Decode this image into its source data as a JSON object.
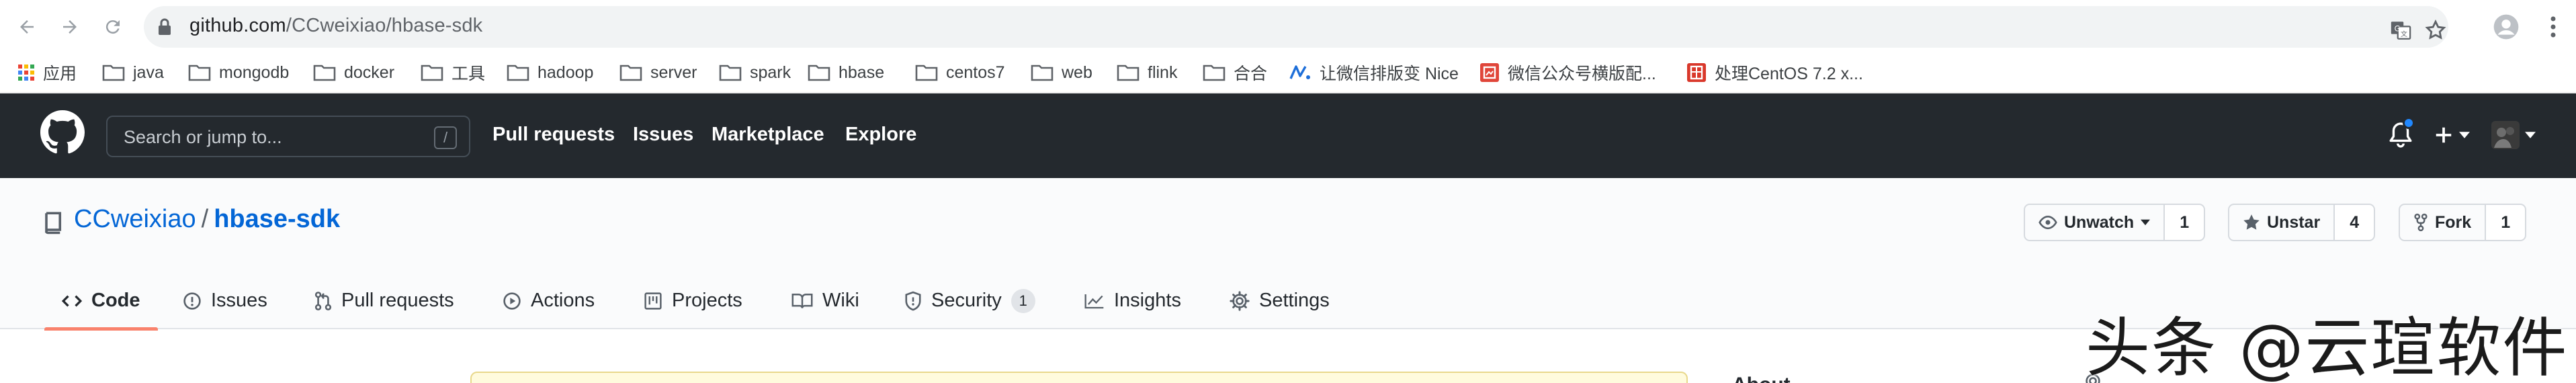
{
  "browser": {
    "url_host": "github.com",
    "url_path": "/CCweixiao/hbase-sdk"
  },
  "bookmarks": [
    {
      "label": "应用",
      "icon": "apps-grid-icon"
    },
    {
      "label": "java",
      "icon": "folder-icon"
    },
    {
      "label": "mongodb",
      "icon": "folder-icon"
    },
    {
      "label": "docker",
      "icon": "folder-icon"
    },
    {
      "label": "工具",
      "icon": "folder-icon"
    },
    {
      "label": "hadoop",
      "icon": "folder-icon"
    },
    {
      "label": "server",
      "icon": "folder-icon"
    },
    {
      "label": "spark",
      "icon": "folder-icon"
    },
    {
      "label": "hbase",
      "icon": "folder-icon"
    },
    {
      "label": "centos7",
      "icon": "folder-icon"
    },
    {
      "label": "web",
      "icon": "folder-icon"
    },
    {
      "label": "flink",
      "icon": "folder-icon"
    },
    {
      "label": "合合",
      "icon": "folder-icon"
    },
    {
      "label": "让微信排版变 Nice",
      "icon": "nice-logo-icon"
    },
    {
      "label": "微信公众号横版配...",
      "icon": "red-square-icon"
    },
    {
      "label": "处理CentOS 7.2 x...",
      "icon": "red-square-icon"
    }
  ],
  "github_header": {
    "search_placeholder": "Search or jump to...",
    "search_shortcut": "/",
    "nav": [
      "Pull requests",
      "Issues",
      "Marketplace",
      "Explore"
    ]
  },
  "repo": {
    "owner": "CCweixiao",
    "separator": "/",
    "name": "hbase-sdk",
    "watch_label": "Unwatch",
    "watch_count": "1",
    "star_label": "Unstar",
    "star_count": "4",
    "fork_label": "Fork",
    "fork_count": "1"
  },
  "tabs": [
    {
      "label": "Code",
      "icon": "code-icon",
      "active": true
    },
    {
      "label": "Issues",
      "icon": "issue-opened-icon"
    },
    {
      "label": "Pull requests",
      "icon": "git-pull-request-icon"
    },
    {
      "label": "Actions",
      "icon": "play-icon"
    },
    {
      "label": "Projects",
      "icon": "project-icon"
    },
    {
      "label": "Wiki",
      "icon": "book-icon"
    },
    {
      "label": "Security",
      "icon": "shield-icon",
      "badge": "1"
    },
    {
      "label": "Insights",
      "icon": "graph-icon"
    },
    {
      "label": "Settings",
      "icon": "gear-icon"
    }
  ],
  "sidebar": {
    "about_heading": "About"
  },
  "watermark": "头条 @云瑄软件",
  "colors": {
    "header_bg": "#24292e",
    "link": "#0366d6",
    "active_tab_underline": "#f9826c",
    "bell_dot": "#2188ff"
  }
}
